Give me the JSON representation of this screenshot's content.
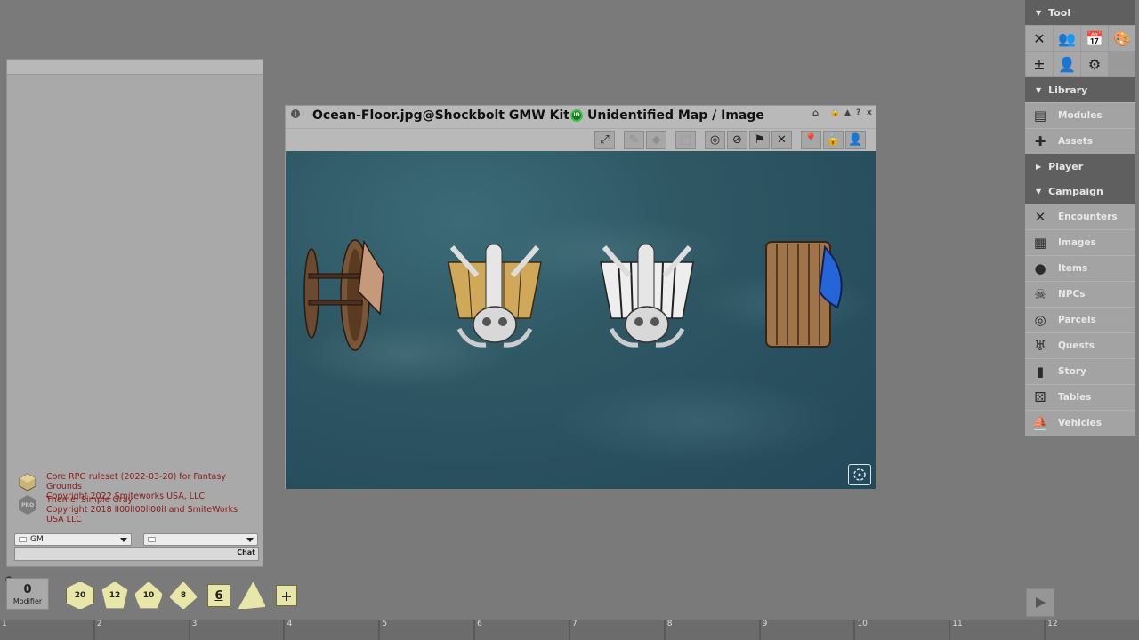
{
  "chat": {
    "credit1_line1": "Core RPG ruleset (2022-03-20) for Fantasy Grounds",
    "credit1_line2": "Copyright 2022 Smiteworks USA, LLC",
    "credit2_badge": "PRO",
    "credit2_line1": "Theme: Simple Gray",
    "credit2_line2": "Copyright 2018 lI00lI00lI00lI and SmiteWorks USA LLC",
    "identity_select": "GM",
    "language_select": "",
    "chat_button": "Chat"
  },
  "modifier": {
    "value": "0",
    "label": "Modifier"
  },
  "dice": [
    "20",
    "12",
    "10",
    "8",
    "6",
    "",
    "+"
  ],
  "hotkeys": [
    "1",
    "2",
    "3",
    "4",
    "5",
    "6",
    "7",
    "8",
    "9",
    "10",
    "11",
    "12"
  ],
  "image_window": {
    "title": "Ocean-Floor.jpg@Shockbolt GMW Kit 1",
    "id_badge": "ID",
    "subtitle": "Unidentified Map / Image",
    "controls": [
      "▲",
      "?",
      "x"
    ],
    "toolbar": [
      "expand-icon",
      "paint-icon",
      "eraser-icon",
      "select-icon",
      "target-icon",
      "mask-icon",
      "flag-icon",
      "swords-icon",
      "pin-icon",
      "lock-icon",
      "player-view-icon"
    ]
  },
  "sidebar": {
    "tool_header": "Tool",
    "tools": [
      "swords-icon",
      "people-icon",
      "calendar-icon",
      "palette-icon",
      "plus-minus-icon",
      "person-add-icon",
      "gear-icon"
    ],
    "library_header": "Library",
    "library_items": [
      {
        "label": "Modules",
        "icon": "book-icon"
      },
      {
        "label": "Assets",
        "icon": "puzzle-icon"
      }
    ],
    "player_header": "Player",
    "campaign_header": "Campaign",
    "campaign_items": [
      {
        "label": "Encounters",
        "icon": "swords-icon"
      },
      {
        "label": "Images",
        "icon": "map-icon"
      },
      {
        "label": "Items",
        "icon": "bag-icon"
      },
      {
        "label": "NPCs",
        "icon": "skull-icon"
      },
      {
        "label": "Parcels",
        "icon": "coins-icon"
      },
      {
        "label": "Quests",
        "icon": "goblet-icon"
      },
      {
        "label": "Story",
        "icon": "tome-icon"
      },
      {
        "label": "Tables",
        "icon": "dice-icon"
      },
      {
        "label": "Vehicles",
        "icon": "ship-icon"
      }
    ]
  },
  "colors": {
    "background": "#7a7a7a",
    "credit_text": "#8b1a1a",
    "die_fill": "#e8e6a8",
    "sea": "#2e5663",
    "header": "#5f5f5f"
  }
}
